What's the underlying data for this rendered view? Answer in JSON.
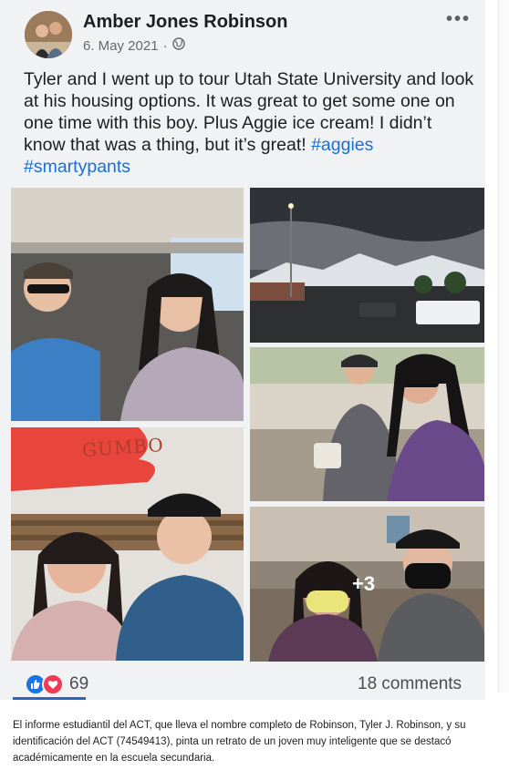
{
  "post": {
    "author": "Amber Jones Robinson",
    "date": "6. May 2021",
    "separator": "·",
    "more_label": "•••",
    "text": "Tyler and I went up to tour Utah State University and look at his housing options. It was great to get some one on one time with this boy. Plus Aggie ice cream! I didn’t know that was a thing, but it’s great!",
    "hashtags": [
      "#aggies",
      "#smartypants"
    ]
  },
  "photos": {
    "sign_text": "GUMBO",
    "more_count": "+3"
  },
  "footer": {
    "reaction_count": "69",
    "comments": "18 comments"
  },
  "caption": "El informe estudiantil del ACT, que lleva el nombre completo de Robinson, Tyler J. Robinson, y su identificación del ACT (74549413), pinta un retrato de un joven muy inteligente que se destacó académicamente en la escuela secundaria.",
  "colors": {
    "hashtag": "#1a6ed8",
    "like": "#1b74e4",
    "love": "#f23a55",
    "underline": "#2e62c7"
  },
  "icons": [
    "globe-icon",
    "more-options-icon",
    "like-reaction-icon",
    "love-reaction-icon"
  ]
}
